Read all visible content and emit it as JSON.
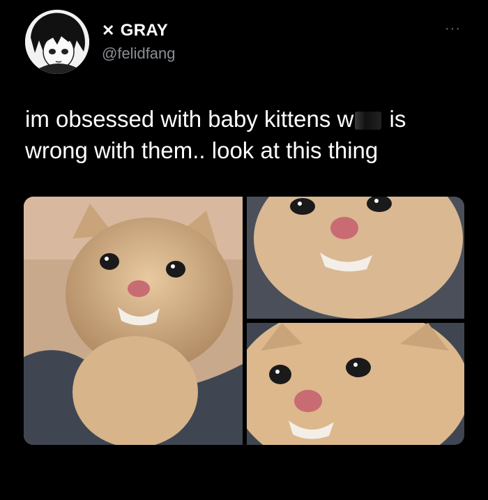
{
  "author": {
    "display_name": "GRAY",
    "name_prefix_icon": "x-icon",
    "handle": "@felidfang",
    "avatar_icon": "anime-avatar"
  },
  "more_label": "···",
  "tweet": {
    "text_part1": "im obsessed with baby kittens w",
    "text_part2": " is wrong with them.. look at this thing"
  },
  "media": {
    "images": [
      {
        "name": "kitten-photo-left"
      },
      {
        "name": "kitten-photo-top-right"
      },
      {
        "name": "kitten-photo-bottom-right"
      }
    ]
  }
}
